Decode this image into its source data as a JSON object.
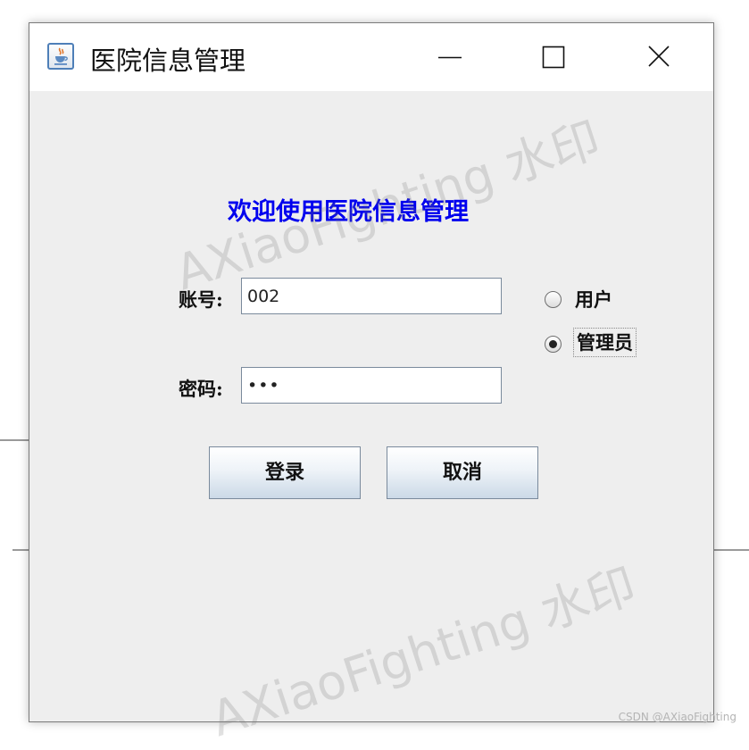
{
  "window": {
    "title": "医院信息管理",
    "controls": {
      "minimize": "minimize",
      "maximize": "maximize",
      "close": "close"
    }
  },
  "form": {
    "welcome_text": "欢迎使用医院信息管理",
    "account_label": "账号:",
    "account_value": "002",
    "password_label": "密码:",
    "password_value": "•••",
    "role_options": [
      {
        "label": "用户",
        "selected": false
      },
      {
        "label": "管理员",
        "selected": true
      }
    ],
    "login_button": "登录",
    "cancel_button": "取消"
  },
  "watermark": {
    "text": "AXiaoFighting 水印",
    "footer": "CSDN @AXiaoFighting"
  },
  "colors": {
    "welcome_text": "#0000ee",
    "window_bg": "#eeeeee",
    "titlebar_bg": "#ffffff",
    "button_gradient_bottom": "#cbd9e7"
  },
  "icons": {
    "app": "java-cup-icon",
    "minimize": "minimize-icon",
    "maximize": "maximize-icon",
    "close": "close-icon",
    "radio_unselected": "radio-empty-icon",
    "radio_selected": "radio-filled-icon"
  }
}
